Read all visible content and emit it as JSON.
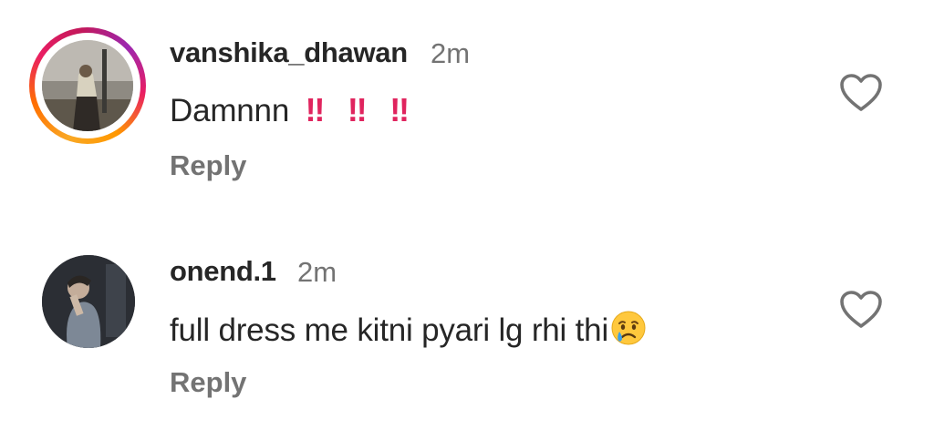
{
  "comments": [
    {
      "username": "vanshika_dhawan",
      "time": "2m",
      "text": "Damnnn",
      "emphasis": [
        "‼",
        "‼",
        "‼"
      ],
      "reply_label": "Reply",
      "has_story_ring": true
    },
    {
      "username": "onend.1",
      "time": "2m",
      "text": "full dress me kitni pyari lg rhi thi",
      "emoji": "crying-face",
      "reply_label": "Reply",
      "has_story_ring": false
    }
  ],
  "colors": {
    "username": "#262626",
    "secondary": "#737373",
    "emphasis": "#e0245e"
  },
  "icons": {
    "like": "heart-outline-icon"
  }
}
